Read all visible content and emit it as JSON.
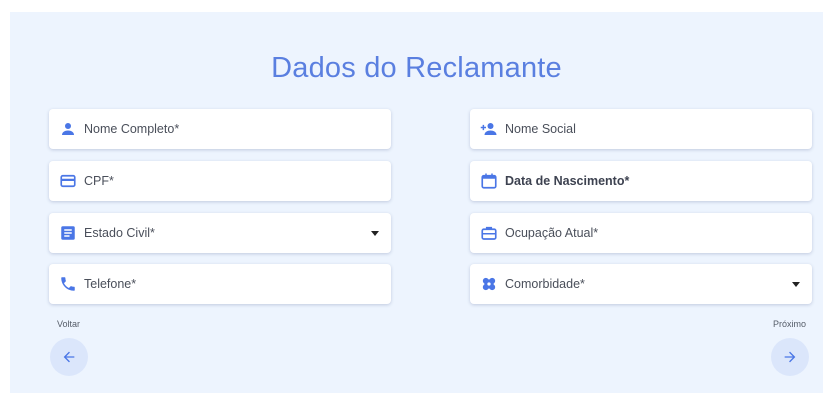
{
  "form": {
    "title": "Dados do Reclamante",
    "fields_left": [
      {
        "label": "Nome Completo*",
        "icon": "person-icon"
      },
      {
        "label": "CPF*",
        "icon": "credit-card-icon"
      },
      {
        "label": "Estado Civil*",
        "icon": "document-icon",
        "dropdown": true
      },
      {
        "label": "Telefone*",
        "icon": "phone-icon"
      }
    ],
    "fields_right": [
      {
        "label": "Nome Social",
        "icon": "person-add-icon"
      },
      {
        "label": "Data de Nascimento*",
        "icon": "calendar-icon"
      },
      {
        "label": "Ocupação Atual*",
        "icon": "briefcase-icon"
      },
      {
        "label": "Comorbidade*",
        "icon": "bandage-icon",
        "dropdown": true
      }
    ]
  },
  "nav": {
    "back_label": "Voltar",
    "next_label": "Próximo"
  },
  "colors": {
    "accent": "#5a7fe0",
    "icon": "#4a76e6",
    "panel_bg": "#edf4fe",
    "nav_button_bg": "#dbe6fb"
  }
}
